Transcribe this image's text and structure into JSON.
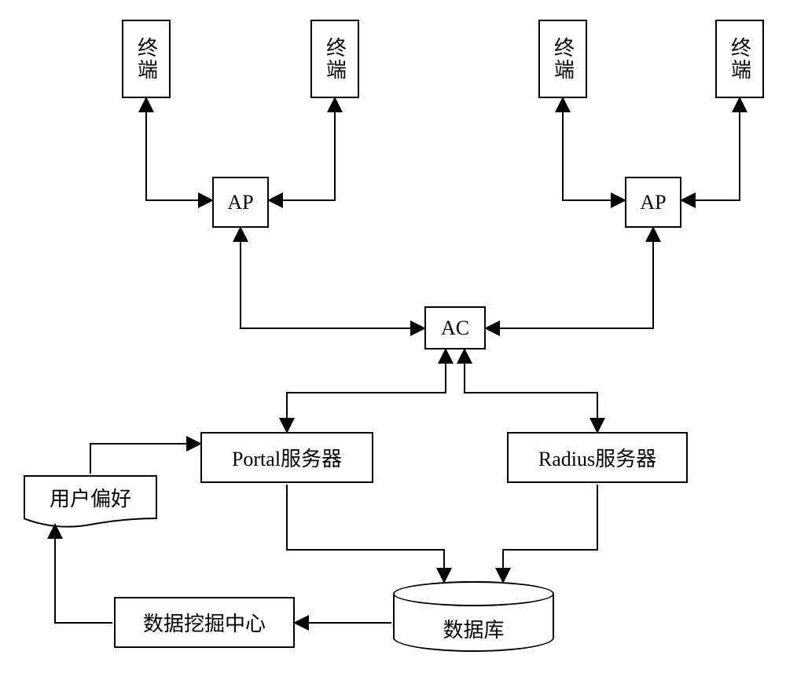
{
  "nodes": {
    "terminal1": "终端",
    "terminal2": "终端",
    "terminal3": "终端",
    "terminal4": "终端",
    "ap_left": "AP",
    "ap_right": "AP",
    "ac": "AC",
    "portal_server": "Portal服务器",
    "radius_server": "Radius服务器",
    "user_preference": "用户偏好",
    "data_mining_center": "数据挖掘中心",
    "database": "数据库"
  },
  "chart_data": {
    "type": "diagram",
    "title": "",
    "components": [
      {
        "id": "terminal1",
        "label": "终端",
        "shape": "rect"
      },
      {
        "id": "terminal2",
        "label": "终端",
        "shape": "rect"
      },
      {
        "id": "terminal3",
        "label": "终端",
        "shape": "rect"
      },
      {
        "id": "terminal4",
        "label": "终端",
        "shape": "rect"
      },
      {
        "id": "ap_left",
        "label": "AP",
        "shape": "rect"
      },
      {
        "id": "ap_right",
        "label": "AP",
        "shape": "rect"
      },
      {
        "id": "ac",
        "label": "AC",
        "shape": "rect"
      },
      {
        "id": "portal_server",
        "label": "Portal服务器",
        "shape": "rect"
      },
      {
        "id": "radius_server",
        "label": "Radius服务器",
        "shape": "rect"
      },
      {
        "id": "user_preference",
        "label": "用户偏好",
        "shape": "document"
      },
      {
        "id": "data_mining_center",
        "label": "数据挖掘中心",
        "shape": "rect"
      },
      {
        "id": "database",
        "label": "数据库",
        "shape": "cylinder"
      }
    ],
    "edges": [
      {
        "from": "terminal1",
        "to": "ap_left",
        "bidir": true
      },
      {
        "from": "terminal2",
        "to": "ap_left",
        "bidir": true
      },
      {
        "from": "terminal3",
        "to": "ap_right",
        "bidir": true
      },
      {
        "from": "terminal4",
        "to": "ap_right",
        "bidir": true
      },
      {
        "from": "ap_left",
        "to": "ac",
        "bidir": true
      },
      {
        "from": "ap_right",
        "to": "ac",
        "bidir": true
      },
      {
        "from": "ac",
        "to": "portal_server",
        "bidir": true
      },
      {
        "from": "ac",
        "to": "radius_server",
        "bidir": true
      },
      {
        "from": "portal_server",
        "to": "database",
        "bidir": false
      },
      {
        "from": "radius_server",
        "to": "database",
        "bidir": false
      },
      {
        "from": "database",
        "to": "data_mining_center",
        "bidir": false
      },
      {
        "from": "data_mining_center",
        "to": "user_preference",
        "bidir": false
      },
      {
        "from": "user_preference",
        "to": "portal_server",
        "bidir": false
      }
    ]
  }
}
